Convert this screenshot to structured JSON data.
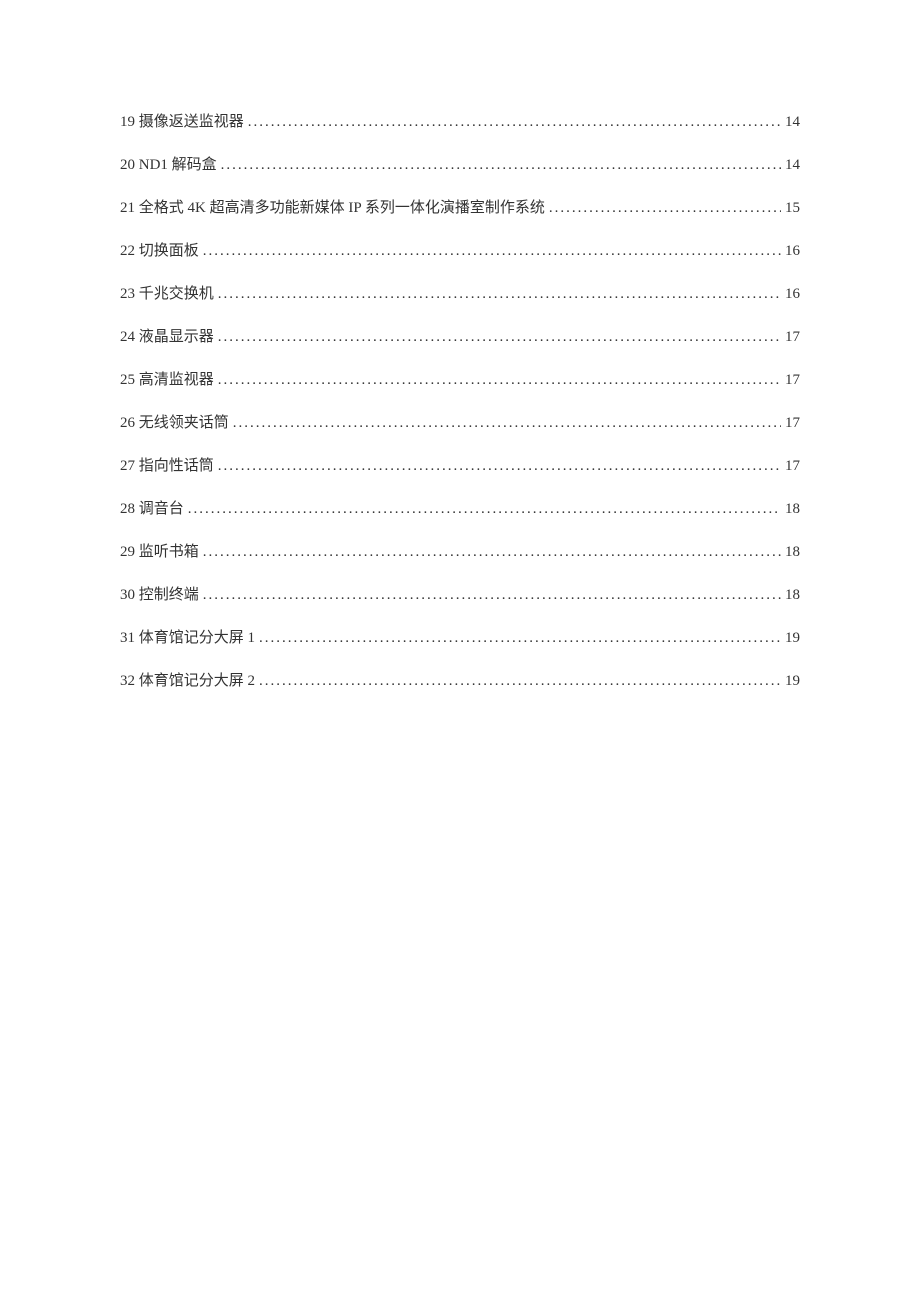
{
  "toc": [
    {
      "num": "19",
      "title": "摄像返送监视器",
      "page": "14"
    },
    {
      "num": "20",
      "title": "ND1 解码盒",
      "page": "14"
    },
    {
      "num": "21",
      "title": "全格式 4K 超高清多功能新媒体 IP 系列一体化演播室制作系统",
      "page": "15"
    },
    {
      "num": "22",
      "title": "切换面板",
      "page": "16"
    },
    {
      "num": "23",
      "title": "千兆交换机",
      "page": "16"
    },
    {
      "num": "24",
      "title": "液晶显示器",
      "page": "17"
    },
    {
      "num": "25",
      "title": "高清监视器",
      "page": "17"
    },
    {
      "num": "26",
      "title": "无线领夹话筒",
      "page": "17"
    },
    {
      "num": "27",
      "title": "指向性话筒",
      "page": "17"
    },
    {
      "num": "28",
      "title": "调音台",
      "page": "18"
    },
    {
      "num": "29",
      "title": "监听书箱",
      "page": "18"
    },
    {
      "num": "30",
      "title": "控制终端",
      "page": "18"
    },
    {
      "num": "31",
      "title": "体育馆记分大屏 1",
      "page": "19"
    },
    {
      "num": "32",
      "title": "体育馆记分大屏 2",
      "page": "19"
    }
  ]
}
